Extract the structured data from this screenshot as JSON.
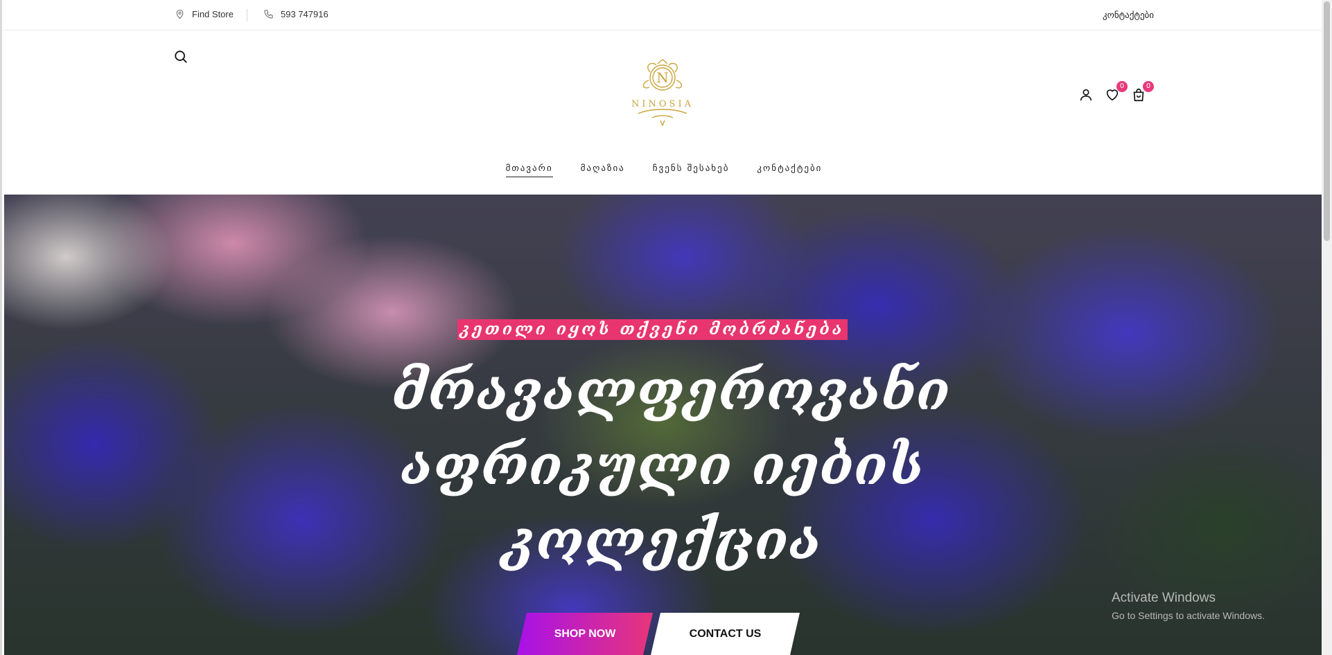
{
  "topbar": {
    "store_label": "Find Store",
    "phone": "593 747916",
    "contact_link": "კონტაქტები"
  },
  "header": {
    "logo_text": "NINOSIA",
    "logo_monogram": "N",
    "wishlist_count": "0",
    "cart_count": "0",
    "icons": [
      "search-icon",
      "user-icon",
      "heart-icon",
      "bag-icon"
    ]
  },
  "nav": {
    "items": [
      {
        "label": "მთავარი",
        "active": true
      },
      {
        "label": "მაღაზია"
      },
      {
        "label": "ჩვენს შესახებ"
      },
      {
        "label": "კონტაქტები"
      }
    ]
  },
  "hero": {
    "tagline": "კეთილი იყოს თქვენი მობრძანება",
    "title_line1": "მრავალფეროვანი",
    "title_line2": "აფრიკული იების",
    "title_line3": "კოლექცია",
    "shop_button": "SHOP NOW",
    "contact_button": "CONTACT US"
  },
  "overlay": {
    "activate_title": "Activate Windows",
    "activate_sub": "Go to Settings to activate Windows."
  },
  "colors": {
    "accent_pink": "#e8356f",
    "gradient_start": "#a811e8",
    "logo_gold": "#c9a43a"
  }
}
